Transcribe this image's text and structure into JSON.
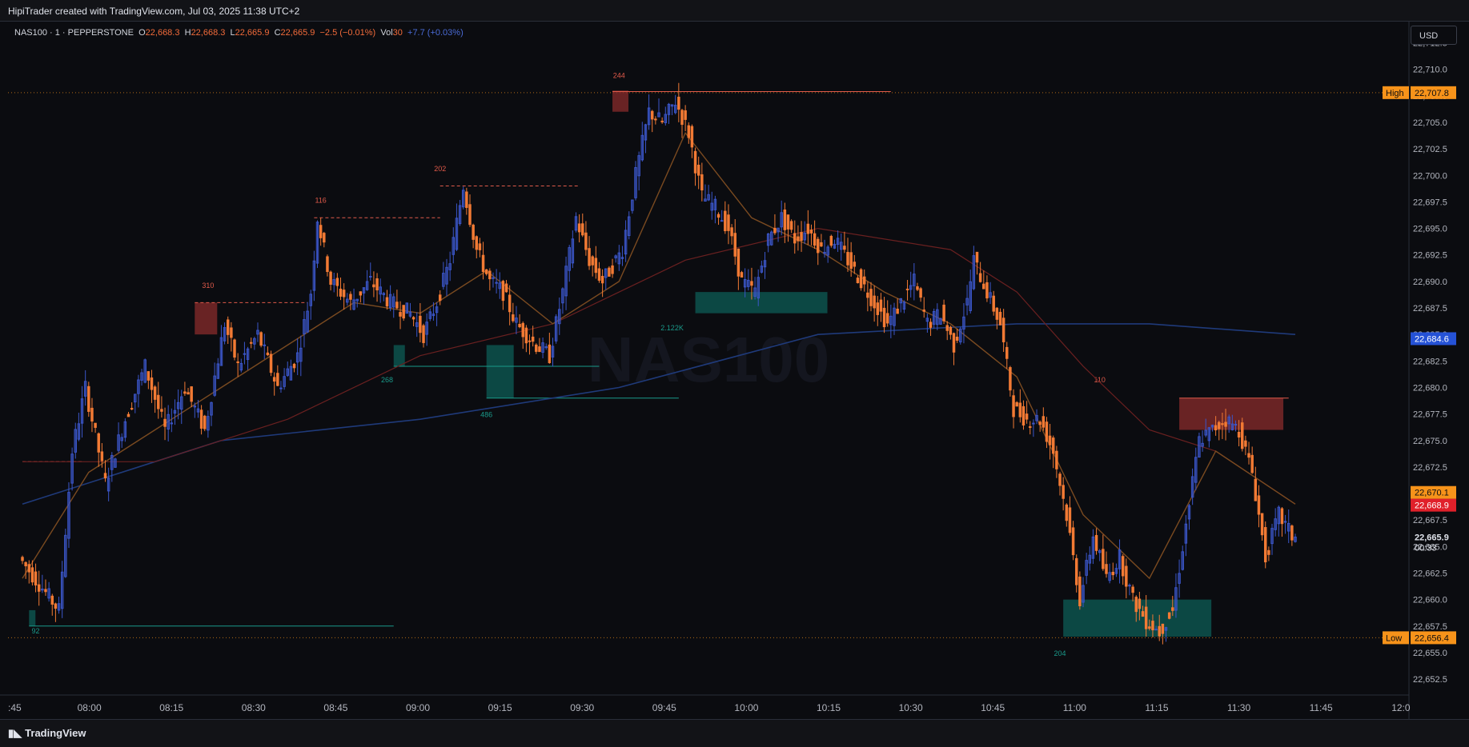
{
  "header": {
    "credit": "HipiTrader created with TradingView.com, Jul 03, 2025 11:38 UTC+2"
  },
  "legend": {
    "symbol": "NAS100 · 1 · PEPPERSTONE",
    "o_label": "O",
    "o_val": "22,668.3",
    "h_label": "H",
    "h_val": "22,668.3",
    "l_label": "L",
    "l_val": "22,665.9",
    "c_label": "C",
    "c_val": "22,665.9",
    "change": "−2.5 (−0.01%)",
    "vol_label": "Vol",
    "vol_val": "30",
    "vol_change": "+7.7 (+0.03%)"
  },
  "currency_button": "USD",
  "watermark": "NAS100",
  "footer": {
    "brand": "TradingView"
  },
  "colors": {
    "bull": "#3b56c9",
    "bear": "#f27a34",
    "ema_fast": "#7a4a20",
    "ema_mid": "#6a2020",
    "ema_slow": "#1f3a7a",
    "supply": "#8a2b2b",
    "demand": "#0d5c55",
    "high_low_label": "#f7931a"
  },
  "chart_data": {
    "type": "candlestick",
    "symbol": "NAS100",
    "timeframe": "1",
    "ylim": [
      22651.0,
      22714.5
    ],
    "y_ticks": [
      "22,712.5",
      "22,710.0",
      "22,707.5",
      "22,705.0",
      "22,702.5",
      "22,700.0",
      "22,697.5",
      "22,695.0",
      "22,692.5",
      "22,690.0",
      "22,687.5",
      "22,685.0",
      "22,682.5",
      "22,680.0",
      "22,677.5",
      "22,675.0",
      "22,672.5",
      "22,670.0",
      "22,667.5",
      "22,665.0",
      "22,662.5",
      "22,660.0",
      "22,657.5",
      "22,655.0",
      "22,652.5"
    ],
    "x_ticks": [
      ":45",
      "08:00",
      "08:15",
      "08:30",
      "08:45",
      "09:00",
      "09:15",
      "09:30",
      "09:45",
      "10:00",
      "10:15",
      "10:30",
      "10:45",
      "11:00",
      "11:15",
      "11:30",
      "11:45",
      "12:0"
    ],
    "price_labels": {
      "high": {
        "label": "High",
        "value": "22,707.8"
      },
      "low": {
        "label": "Low",
        "value": "22,656.4"
      },
      "ema_slow": {
        "value": "22,684.6"
      },
      "ema_fast": {
        "value": "22,670.1"
      },
      "last": {
        "value": "22,668.9"
      },
      "current": {
        "value": "22,665.9",
        "countdown": "00:33"
      }
    },
    "zone_labels": [
      {
        "text": "310"
      },
      {
        "text": "116"
      },
      {
        "text": "202"
      },
      {
        "text": "244"
      },
      {
        "text": "268"
      },
      {
        "text": "486"
      },
      {
        "text": "2.122K"
      },
      {
        "text": "92"
      },
      {
        "text": "110"
      },
      {
        "text": "204"
      }
    ],
    "price_path": [
      [
        0,
        22664
      ],
      [
        12,
        22659
      ],
      [
        16,
        22674
      ],
      [
        20,
        22680
      ],
      [
        26,
        22671
      ],
      [
        32,
        22677
      ],
      [
        38,
        22682
      ],
      [
        44,
        22676
      ],
      [
        50,
        22680
      ],
      [
        56,
        22676
      ],
      [
        62,
        22686
      ],
      [
        66,
        22682
      ],
      [
        72,
        22685
      ],
      [
        78,
        22680
      ],
      [
        84,
        22683
      ],
      [
        88,
        22689
      ],
      [
        90,
        22696
      ],
      [
        94,
        22690
      ],
      [
        100,
        22688
      ],
      [
        106,
        22690
      ],
      [
        112,
        22688
      ],
      [
        118,
        22687
      ],
      [
        122,
        22685
      ],
      [
        126,
        22688
      ],
      [
        130,
        22692
      ],
      [
        134,
        22699
      ],
      [
        138,
        22693
      ],
      [
        142,
        22690
      ],
      [
        146,
        22689
      ],
      [
        150,
        22686
      ],
      [
        156,
        22684
      ],
      [
        160,
        22683
      ],
      [
        164,
        22689
      ],
      [
        168,
        22696
      ],
      [
        172,
        22692
      ],
      [
        176,
        22690
      ],
      [
        182,
        22693
      ],
      [
        186,
        22700
      ],
      [
        190,
        22706
      ],
      [
        194,
        22705
      ],
      [
        198,
        22707
      ],
      [
        202,
        22704
      ],
      [
        206,
        22698
      ],
      [
        210,
        22697
      ],
      [
        214,
        22695
      ],
      [
        218,
        22690
      ],
      [
        222,
        22689
      ],
      [
        226,
        22694
      ],
      [
        230,
        22696
      ],
      [
        234,
        22694
      ],
      [
        238,
        22695
      ],
      [
        242,
        22693
      ],
      [
        246,
        22694
      ],
      [
        250,
        22692
      ],
      [
        254,
        22690
      ],
      [
        258,
        22688
      ],
      [
        262,
        22686
      ],
      [
        266,
        22688
      ],
      [
        270,
        22690
      ],
      [
        274,
        22686
      ],
      [
        278,
        22687
      ],
      [
        282,
        22684
      ],
      [
        286,
        22688
      ],
      [
        288,
        22692
      ],
      [
        292,
        22689
      ],
      [
        296,
        22686
      ],
      [
        300,
        22678
      ],
      [
        304,
        22677
      ],
      [
        308,
        22677
      ],
      [
        312,
        22674
      ],
      [
        316,
        22668
      ],
      [
        320,
        22660
      ],
      [
        324,
        22666
      ],
      [
        328,
        22662
      ],
      [
        332,
        22664
      ],
      [
        336,
        22660
      ],
      [
        340,
        22658
      ],
      [
        344,
        22657
      ],
      [
        348,
        22659
      ],
      [
        352,
        22667
      ],
      [
        356,
        22675
      ],
      [
        360,
        22676
      ],
      [
        364,
        22677
      ],
      [
        368,
        22676
      ],
      [
        372,
        22672
      ],
      [
        376,
        22664
      ],
      [
        380,
        22668
      ],
      [
        384,
        22666
      ]
    ],
    "ema_fast": [
      [
        0,
        22662
      ],
      [
        20,
        22672
      ],
      [
        40,
        22676
      ],
      [
        60,
        22680
      ],
      [
        80,
        22684
      ],
      [
        100,
        22688
      ],
      [
        120,
        22687
      ],
      [
        140,
        22691
      ],
      [
        160,
        22686
      ],
      [
        180,
        22690
      ],
      [
        200,
        22704
      ],
      [
        220,
        22696
      ],
      [
        240,
        22693
      ],
      [
        260,
        22689
      ],
      [
        280,
        22686
      ],
      [
        300,
        22681
      ],
      [
        320,
        22668
      ],
      [
        340,
        22662
      ],
      [
        360,
        22674
      ],
      [
        384,
        22669
      ]
    ],
    "ema_mid": [
      [
        0,
        22673
      ],
      [
        40,
        22673
      ],
      [
        80,
        22677
      ],
      [
        120,
        22683
      ],
      [
        160,
        22686
      ],
      [
        200,
        22692
      ],
      [
        240,
        22695
      ],
      [
        280,
        22693
      ],
      [
        300,
        22689
      ],
      [
        320,
        22682
      ],
      [
        340,
        22676
      ],
      [
        360,
        22674
      ],
      [
        384,
        22669
      ]
    ],
    "ema_slow": [
      [
        0,
        22669
      ],
      [
        60,
        22675
      ],
      [
        120,
        22677
      ],
      [
        180,
        22680
      ],
      [
        240,
        22685
      ],
      [
        300,
        22686
      ],
      [
        340,
        22686
      ],
      [
        384,
        22685
      ]
    ]
  }
}
